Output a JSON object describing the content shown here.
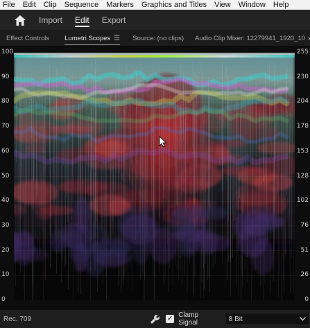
{
  "menu": [
    "File",
    "Edit",
    "Clip",
    "Sequence",
    "Markers",
    "Graphics and Titles",
    "View",
    "Window",
    "Help"
  ],
  "workspaces": [
    {
      "label": "Import",
      "active": false
    },
    {
      "label": "Edit",
      "active": true
    },
    {
      "label": "Export",
      "active": false
    }
  ],
  "panel_tabs": {
    "effect_controls": "Effect Controls",
    "lumetri_scopes": "Lumetri Scopes",
    "source": "Source: (no clips)",
    "audio_mixer": "Audio Clip Mixer: 12279941_1920_10",
    "overflow": "»"
  },
  "scope": {
    "left_ticks": [
      "100",
      "90",
      "80",
      "70",
      "60",
      "50",
      "40",
      "30",
      "20",
      "10",
      "0"
    ],
    "right_ticks": [
      "255",
      "230",
      "204",
      "178",
      "153",
      "128",
      "102",
      "76",
      "51",
      "26",
      "0"
    ]
  },
  "footer": {
    "standard": "Rec. 709",
    "clamp_label": "Clamp Signal",
    "clamp_checked": "✓",
    "bit_depth": "8 Bit"
  },
  "icons": {
    "home": "home-icon",
    "wrench": "wrench-icon",
    "dropdown": "chevron-down-icon"
  }
}
